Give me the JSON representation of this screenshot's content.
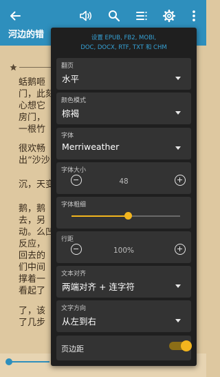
{
  "topbar": {
    "title": "河边的错",
    "icons": [
      "back-arrow-icon",
      "speaker-icon",
      "search-icon",
      "toc-icon",
      "gear-icon",
      "more-vert-icon"
    ]
  },
  "reader": {
    "lines": [
      "蛞鹅咂",
      "门，此刻",
      "心想它",
      "房门，",
      "一根竹",
      "很欢畅",
      "出“沙沙",
      "沉，天变",
      "鹅，鹅",
      "去，另",
      "动。么凹",
      "反应，",
      "回去的",
      "们中间",
      "撑着一",
      "看起了",
      "了，该",
      "了几步"
    ]
  },
  "settings": {
    "formats_line1": "设置 EPUB, FB2, MOBI,",
    "formats_line2": "DOC, DOCX, RTF, TXT 和 CHM",
    "page_turn": {
      "label": "翻页",
      "value": "水平"
    },
    "color_mode": {
      "label": "颜色模式",
      "value": "棕褐"
    },
    "font": {
      "label": "字体",
      "value": "Merriweather"
    },
    "font_size": {
      "label": "字体大小",
      "value": "48"
    },
    "font_weight": {
      "label": "字体粗细",
      "level": 0.52
    },
    "line_spacing": {
      "label": "行距",
      "value": "100%"
    },
    "text_align": {
      "label": "文本对齐",
      "value": "两端对齐 + 连字符"
    },
    "text_direction": {
      "label": "文字方向",
      "value": "从左到右"
    },
    "page_margin": {
      "label": "页边距",
      "enabled": true
    }
  },
  "colors": {
    "accent_blue": "#2e8fbd",
    "page_sepia": "#dec8a0",
    "panel_bg": "#1f1f1f",
    "card_bg": "#333333",
    "highlight_yellow": "#f2b51e"
  }
}
